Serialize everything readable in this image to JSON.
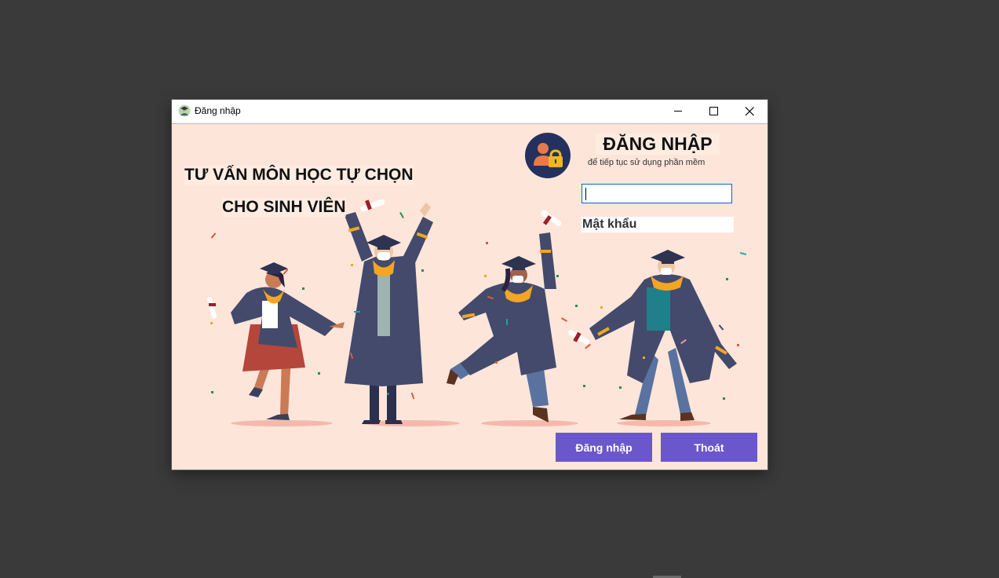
{
  "window": {
    "title": "Đăng nhập",
    "icon": "graduation-app-icon",
    "controls": {
      "minimize": "minimize-icon",
      "maximize": "maximize-icon",
      "close": "close-icon"
    }
  },
  "hero": {
    "line1": "TƯ VẤN MÔN HỌC TỰ CHỌN",
    "line2": "CHO SINH VIÊN",
    "illustration": "graduates-celebrating"
  },
  "login": {
    "icon": "user-lock-icon",
    "title": "ĐĂNG NHẬP",
    "subtitle": "để tiếp tục sử dụng phần mềm",
    "username_value": "",
    "password_label": "Mật khẩu"
  },
  "buttons": {
    "login": "Đăng nhập",
    "exit": "Thoát"
  },
  "colors": {
    "background": "#fde5da",
    "button": "#6a57cc",
    "gown": "#434a6b",
    "stole": "#f3a623",
    "desktop": "#3a3a3a"
  }
}
